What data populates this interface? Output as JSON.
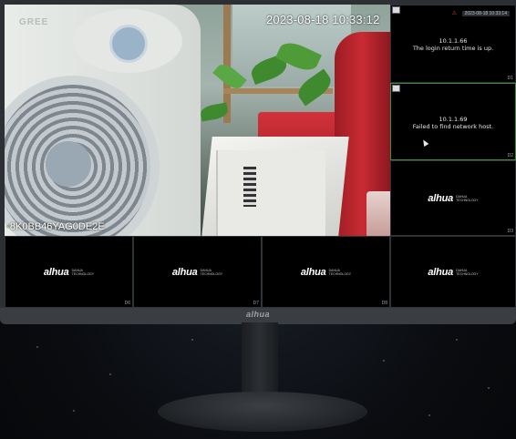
{
  "camera_main": {
    "timestamp": "2023-08-18 10:33:12",
    "device_id": "8K0BB46YAG0DE2E",
    "fan_brand": "GREE"
  },
  "tiles": [
    {
      "id": "tile-top-right-1",
      "time": "2023-08-18 10:33:14",
      "ip": "10.1.1.66",
      "message": "The login return time is up."
    },
    {
      "id": "tile-top-right-2",
      "ip": "10.1.1.69",
      "message": "Failed to find network host."
    },
    {
      "id": "tile-right-3",
      "logo": "alhua",
      "logo_sub": "DAHUA\nTECHNOLOGY"
    },
    {
      "id": "tile-bottom-1",
      "logo": "alhua",
      "logo_sub": "DAHUA\nTECHNOLOGY",
      "num": "D6"
    },
    {
      "id": "tile-bottom-2",
      "logo": "alhua",
      "logo_sub": "DAHUA\nTECHNOLOGY",
      "num": "D7"
    },
    {
      "id": "tile-bottom-3",
      "logo": "alhua",
      "logo_sub": "DAHUA\nTECHNOLOGY",
      "num": "D8"
    },
    {
      "id": "tile-bottom-4",
      "logo": "alhua",
      "logo_sub": "DAHUA\nTECHNOLOGY"
    }
  ],
  "tile_numbers": {
    "t1": "D1",
    "t2": "D2",
    "t3": "D3"
  },
  "bezel_logo": "alhua",
  "colors": {
    "selected_border": "#3d8f3d",
    "alarm": "#e04040"
  }
}
